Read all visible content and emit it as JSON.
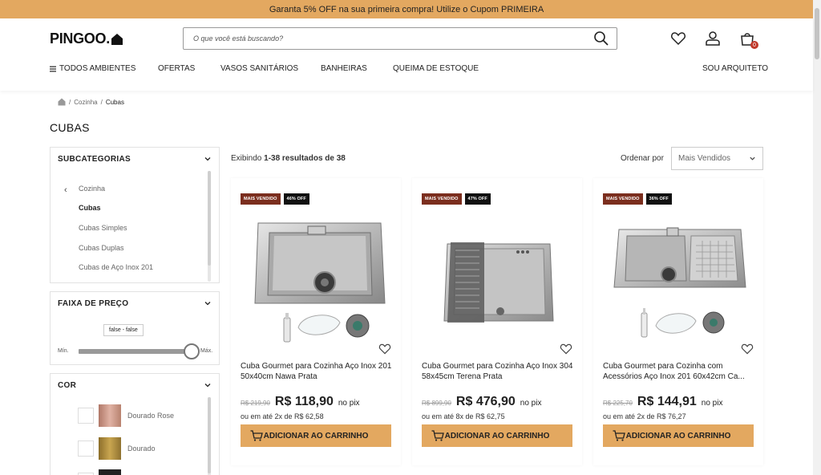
{
  "promo": "Garanta 5% OFF na sua primeira compra! Utilize o Cupom PRIMEIRA",
  "logo": "PINGOO.",
  "search": {
    "placeholder": "O que você está buscando?"
  },
  "header_icons": {
    "cart_count": "0"
  },
  "nav": {
    "all": "TODOS AMBIENTES",
    "items": [
      "OFERTAS",
      "VASOS SANITÁRIOS",
      "BANHEIRAS",
      "QUEIMA DE ESTOQUE"
    ],
    "architect": "SOU ARQUITETO"
  },
  "breadcrumb": {
    "parent": "Cozinha",
    "current": "Cubas"
  },
  "page_title": "CUBAS",
  "subcategories": {
    "title": "SUBCATEGORIAS",
    "back": "Cozinha",
    "items": [
      "Cubas",
      "Cubas Simples",
      "Cubas Duplas",
      "Cubas de Aço Inox 201"
    ]
  },
  "price_filter": {
    "title": "FAIXA DE PREÇO",
    "tooltip": "false - false",
    "min": "Mín.",
    "max": "Máx."
  },
  "color_filter": {
    "title": "COR",
    "items": [
      {
        "label": "Dourado Rose",
        "color": "#c89a8c"
      },
      {
        "label": "Dourado",
        "color": "#a8873a"
      }
    ]
  },
  "results": {
    "prefix": "Exibindo ",
    "range": "1-38 resultados de 38"
  },
  "sort": {
    "label": "Ordenar por",
    "value": "Mais Vendidos"
  },
  "products": [
    {
      "badge_best": "MAIS VENDIDO",
      "badge_off": "46% OFF",
      "name": "Cuba Gourmet para Cozinha Aço Inox 201 50x40cm Nawa Prata",
      "old_price": "R$ 219,90",
      "price": "R$ 118,90",
      "pix": "no pix",
      "installments": "ou em até 2x de R$ 62,58",
      "button": "ADICIONAR AO CARRINHO"
    },
    {
      "badge_best": "MAIS VENDIDO",
      "badge_off": "47% OFF",
      "name": "Cuba Gourmet para Cozinha Aço Inox 304 58x45cm Terena Prata",
      "old_price": "R$ 899,90",
      "price": "R$ 476,90",
      "pix": "no pix",
      "installments": "ou em até 8x de R$ 62,75",
      "button": "ADICIONAR AO CARRINHO"
    },
    {
      "badge_best": "MAIS VENDIDO",
      "badge_off": "36% OFF",
      "name": "Cuba Gourmet para Cozinha com Acessórios Aço Inox 201 60x42cm Ca...",
      "old_price": "R$ 225,70",
      "price": "R$ 144,91",
      "pix": "no pix",
      "installments": "ou em até 2x de R$ 76,27",
      "button": "ADICIONAR AO CARRINHO"
    }
  ]
}
